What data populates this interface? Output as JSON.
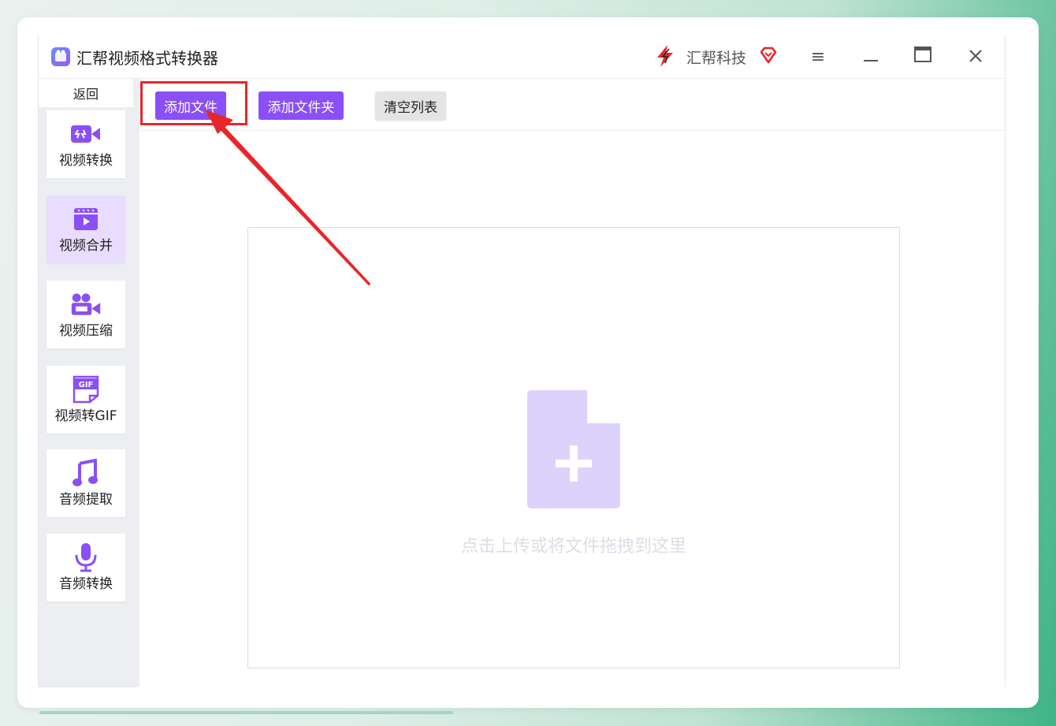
{
  "app": {
    "title": "汇帮视频格式转换器",
    "brand": "汇帮科技"
  },
  "window_controls": {
    "menu": "≡",
    "minimize": "—",
    "maximize": "▭",
    "close": "✕"
  },
  "sidebar": {
    "back": "返回",
    "items": [
      {
        "label": "视频转换",
        "icon": "video-convert-icon",
        "active": false
      },
      {
        "label": "视频合并",
        "icon": "video-merge-icon",
        "active": true
      },
      {
        "label": "视频压缩",
        "icon": "video-compress-icon",
        "active": false
      },
      {
        "label": "视频转GIF",
        "icon": "gif-icon",
        "active": false
      },
      {
        "label": "音频提取",
        "icon": "music-note-icon",
        "active": false
      },
      {
        "label": "音频转换",
        "icon": "microphone-icon",
        "active": false
      }
    ]
  },
  "toolbar": {
    "add_file": "添加文件",
    "add_folder": "添加文件夹",
    "clear_list": "清空列表"
  },
  "dropzone": {
    "hint": "点击上传或将文件拖拽到这里"
  },
  "colors": {
    "accent": "#8a4ff5",
    "highlight": "#e8262a"
  }
}
